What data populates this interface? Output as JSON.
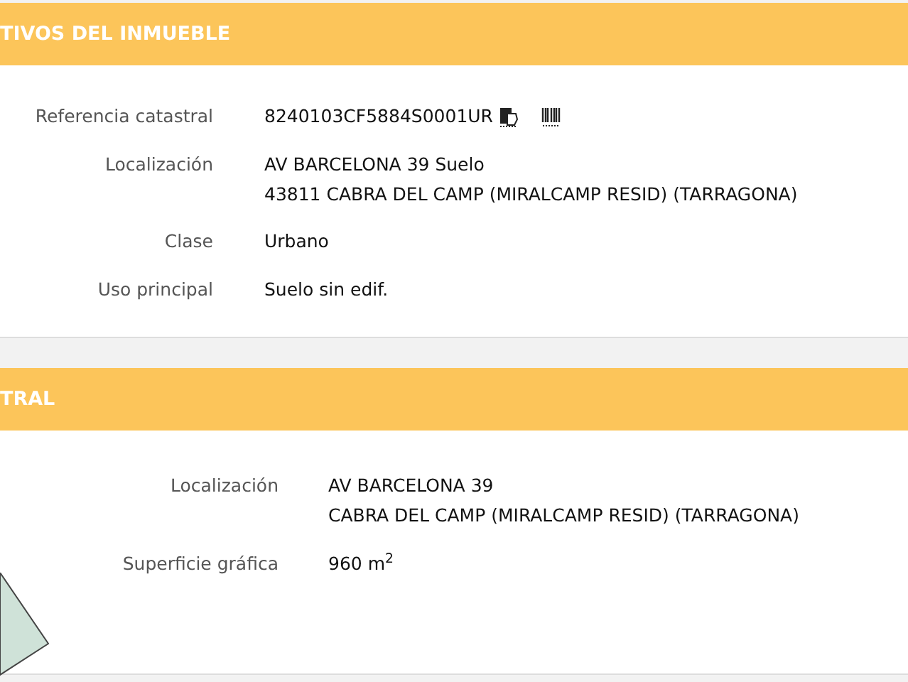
{
  "sections": [
    {
      "title": "TIVOS DEL INMUEBLE",
      "fields": [
        {
          "label": "Referencia catastral",
          "lines": [
            "8240103CF5884S0001UR"
          ],
          "kind": "reference"
        },
        {
          "label": "Localización",
          "lines": [
            "AV BARCELONA 39 Suelo",
            "43811 CABRA DEL CAMP (MIRALCAMP RESID) (TARRAGONA)"
          ],
          "kind": "text"
        },
        {
          "label": "Clase",
          "lines": [
            "Urbano"
          ],
          "kind": "text"
        },
        {
          "label": "Uso principal",
          "lines": [
            "Suelo sin edif."
          ],
          "kind": "text"
        }
      ]
    },
    {
      "title": "TRAL",
      "fields": [
        {
          "label": "Localización",
          "lines": [
            "AV BARCELONA 39",
            "CABRA DEL CAMP (MIRALCAMP RESID) (TARRAGONA)"
          ],
          "kind": "text"
        },
        {
          "label": "Superficie gráfica",
          "lines": [
            "960 m$^{2}$"
          ],
          "kind": "text"
        }
      ]
    }
  ]
}
